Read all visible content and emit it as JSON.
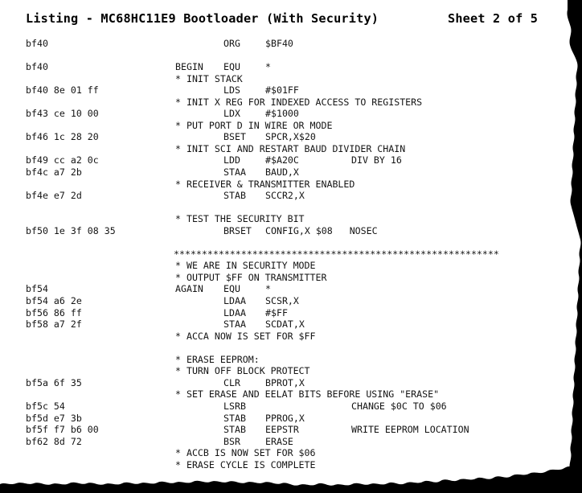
{
  "header": {
    "title": "Listing - MC68HC11E9 Bootloader (With Security)",
    "sheet": "Sheet 2 of 5"
  },
  "listing": {
    "lines": [
      {
        "addr": "bf40",
        "label": "",
        "mnem": "ORG",
        "oper": "$BF40",
        "cmt": ""
      },
      {
        "addr": "",
        "label": "",
        "mnem": "",
        "oper": "",
        "cmt": ""
      },
      {
        "addr": "bf40",
        "label": "BEGIN",
        "mnem": "EQU",
        "oper": "*",
        "cmt": ""
      },
      {
        "addr": "",
        "full": "* INIT STACK"
      },
      {
        "addr": "bf40 8e 01 ff",
        "label": "",
        "mnem": "LDS",
        "oper": "#$01FF",
        "cmt": ""
      },
      {
        "addr": "",
        "full": "* INIT X REG FOR INDEXED ACCESS TO REGISTERS"
      },
      {
        "addr": "bf43 ce 10 00",
        "label": "",
        "mnem": "LDX",
        "oper": "#$1000",
        "cmt": ""
      },
      {
        "addr": "",
        "full": "* PUT PORT D IN WIRE OR MODE"
      },
      {
        "addr": "bf46 1c 28 20",
        "label": "",
        "mnem": "BSET",
        "oper": "SPCR,X$20",
        "cmt": ""
      },
      {
        "addr": "",
        "full": "* INIT SCI AND RESTART BAUD DIVIDER CHAIN"
      },
      {
        "addr": "bf49 cc a2 0c",
        "label": "",
        "mnem": "LDD",
        "oper": "#$A20C",
        "cmt": "DIV BY 16"
      },
      {
        "addr": "bf4c a7 2b",
        "label": "",
        "mnem": "STAA",
        "oper": "BAUD,X",
        "cmt": ""
      },
      {
        "addr": "",
        "full": "* RECEIVER & TRANSMITTER ENABLED"
      },
      {
        "addr": "bf4e e7 2d",
        "label": "",
        "mnem": "STAB",
        "oper": "SCCR2,X",
        "cmt": ""
      },
      {
        "addr": "",
        "label": "",
        "mnem": "",
        "oper": "",
        "cmt": ""
      },
      {
        "addr": "",
        "full": "* TEST THE SECURITY BIT"
      },
      {
        "addr": "bf50 1e 3f 08 35",
        "label": "",
        "mnem": "BRSET",
        "oper": "CONFIG,X $08   NOSEC",
        "cmt": ""
      },
      {
        "addr": "",
        "label": "",
        "mnem": "",
        "oper": "",
        "cmt": ""
      },
      {
        "addr": "",
        "stars": "**********************************************************"
      },
      {
        "addr": "",
        "full": "* WE ARE IN SECURITY MODE"
      },
      {
        "addr": "",
        "full": "* OUTPUT $FF ON TRANSMITTER"
      },
      {
        "addr": "bf54",
        "label": "AGAIN",
        "mnem": "EQU",
        "oper": "*",
        "cmt": ""
      },
      {
        "addr": "bf54 a6 2e",
        "label": "",
        "mnem": "LDAA",
        "oper": "SCSR,X",
        "cmt": ""
      },
      {
        "addr": "bf56 86 ff",
        "label": "",
        "mnem": "LDAA",
        "oper": "#$FF",
        "cmt": ""
      },
      {
        "addr": "bf58 a7 2f",
        "label": "",
        "mnem": "STAA",
        "oper": "SCDAT,X",
        "cmt": ""
      },
      {
        "addr": "",
        "full": "* ACCA NOW IS SET FOR $FF"
      },
      {
        "addr": "",
        "label": "",
        "mnem": "",
        "oper": "",
        "cmt": ""
      },
      {
        "addr": "",
        "full": "* ERASE EEPROM:"
      },
      {
        "addr": "",
        "full": "* TURN OFF BLOCK PROTECT"
      },
      {
        "addr": "bf5a 6f 35",
        "label": "",
        "mnem": "CLR",
        "oper": "BPROT,X",
        "cmt": ""
      },
      {
        "addr": "",
        "full": "* SET ERASE AND EELAT BITS BEFORE USING \"ERASE\""
      },
      {
        "addr": "bf5c 54",
        "label": "",
        "mnem": "LSRB",
        "oper": "",
        "cmt": "CHANGE $0C TO $06"
      },
      {
        "addr": "bf5d e7 3b",
        "label": "",
        "mnem": "STAB",
        "oper": "PPROG,X",
        "cmt": ""
      },
      {
        "addr": "bf5f f7 b6 00",
        "label": "",
        "mnem": "STAB",
        "oper": "EEPSTR",
        "cmt": "WRITE EEPROM LOCATION"
      },
      {
        "addr": "bf62 8d 72",
        "label": "",
        "mnem": "BSR",
        "oper": "ERASE",
        "cmt": ""
      },
      {
        "addr": "",
        "full": "* ACCB IS NOW SET FOR $06"
      },
      {
        "addr": "",
        "full": "* ERASE CYCLE IS COMPLETE"
      }
    ]
  },
  "colors": {
    "paper": "#ffffff",
    "ink": "#141414",
    "title_ink": "#000000",
    "torn_edge": "#000000"
  }
}
